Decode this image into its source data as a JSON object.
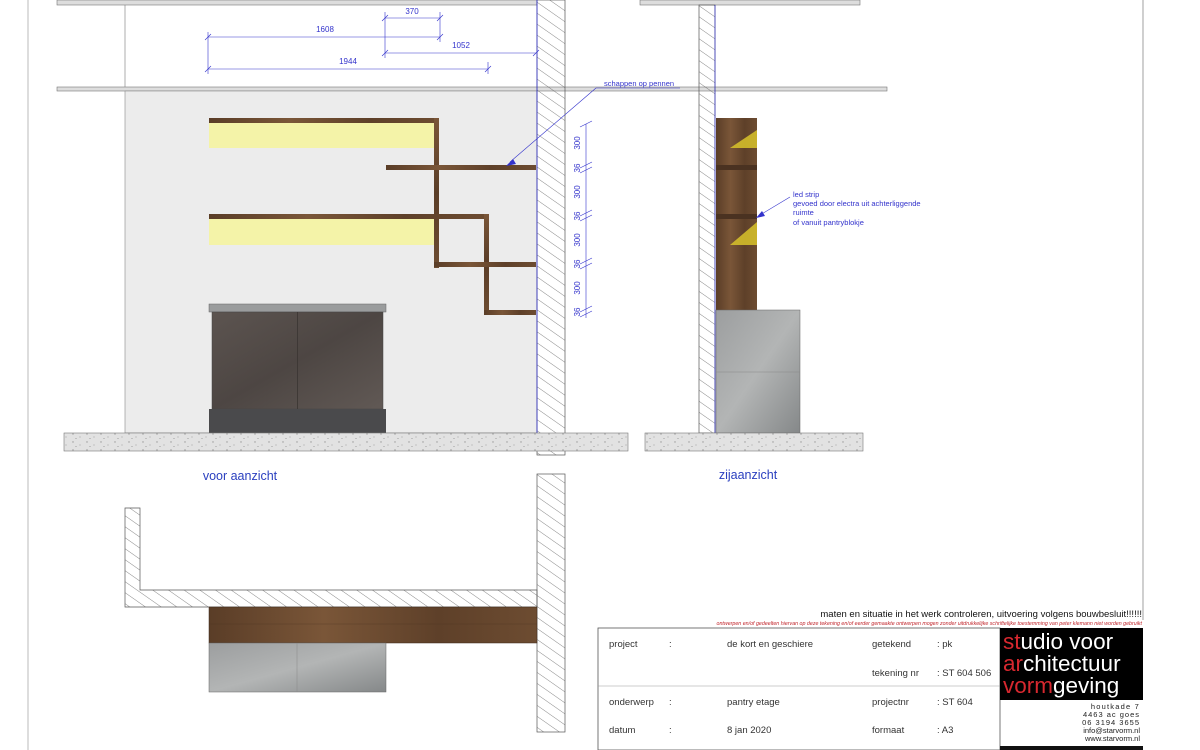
{
  "dimensions": {
    "top": [
      "370",
      "1608",
      "1052",
      "1944"
    ],
    "vertical": [
      "300",
      "36",
      "300",
      "36",
      "300",
      "36",
      "300",
      "36"
    ]
  },
  "annotations": {
    "shelves": "schappen op pennen",
    "led_lines": [
      "led strip",
      "gevoed door electra uit achterliggende",
      "ruimte",
      "of vanuit pantryblokje"
    ]
  },
  "views": {
    "front": "voor aanzicht",
    "side": "zijaanzicht"
  },
  "notice": {
    "warning": "maten en situatie in het werk controleren, uitvoering volgens bouwbesluit!!!!!!",
    "copyright": "ontwerpen en/of gedeelten hiervan op deze tekening en/of eerder gemaakte ontwerpen mogen zonder uitdrukkelijke schriftelijke toestemming van peter klemann niet worden gebruikt"
  },
  "title_block": {
    "rows": [
      {
        "label": "project",
        "colon": ":",
        "value": "de kort en geschiere",
        "label2": "getekend",
        "value2": ": pk"
      },
      {
        "label": "",
        "colon": "",
        "value": "",
        "label2": "tekening nr",
        "value2": ": ST 604 506"
      },
      {
        "label": "onderwerp",
        "colon": ":",
        "value": "pantry etage",
        "label2": "projectnr",
        "value2": ": ST 604"
      },
      {
        "label": "datum",
        "colon": ":",
        "value": "8 jan 2020",
        "label2": "formaat",
        "value2": ": A3"
      }
    ]
  },
  "logo": {
    "lines": [
      {
        "accent": "st",
        "rest": "udio voor"
      },
      {
        "accent": "ar",
        "rest": "chitectuur"
      },
      {
        "accent": "vorm",
        "rest": "geving"
      }
    ],
    "address": [
      "houtkade 7",
      "4463 ac goes",
      "06 3194 3655",
      "info@starvorm.nl",
      "www.starvorm.nl"
    ]
  },
  "colors": {
    "accent_red": "#d7282f",
    "dimension_blue": "#3333cc",
    "wood": "#6b4a30",
    "led_yellow": "#f4f3a8",
    "concrete": "#8d8f90"
  }
}
